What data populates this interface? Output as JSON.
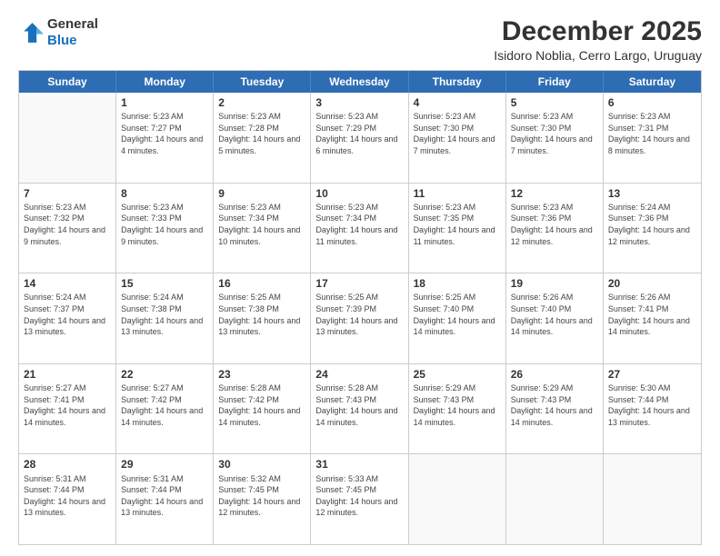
{
  "logo": {
    "line1": "General",
    "line2": "Blue"
  },
  "title": "December 2025",
  "subtitle": "Isidoro Noblia, Cerro Largo, Uruguay",
  "header_days": [
    "Sunday",
    "Monday",
    "Tuesday",
    "Wednesday",
    "Thursday",
    "Friday",
    "Saturday"
  ],
  "weeks": [
    [
      {
        "day": "",
        "empty": true
      },
      {
        "day": "1",
        "sunrise": "Sunrise: 5:23 AM",
        "sunset": "Sunset: 7:27 PM",
        "daylight": "Daylight: 14 hours and 4 minutes."
      },
      {
        "day": "2",
        "sunrise": "Sunrise: 5:23 AM",
        "sunset": "Sunset: 7:28 PM",
        "daylight": "Daylight: 14 hours and 5 minutes."
      },
      {
        "day": "3",
        "sunrise": "Sunrise: 5:23 AM",
        "sunset": "Sunset: 7:29 PM",
        "daylight": "Daylight: 14 hours and 6 minutes."
      },
      {
        "day": "4",
        "sunrise": "Sunrise: 5:23 AM",
        "sunset": "Sunset: 7:30 PM",
        "daylight": "Daylight: 14 hours and 7 minutes."
      },
      {
        "day": "5",
        "sunrise": "Sunrise: 5:23 AM",
        "sunset": "Sunset: 7:30 PM",
        "daylight": "Daylight: 14 hours and 7 minutes."
      },
      {
        "day": "6",
        "sunrise": "Sunrise: 5:23 AM",
        "sunset": "Sunset: 7:31 PM",
        "daylight": "Daylight: 14 hours and 8 minutes."
      }
    ],
    [
      {
        "day": "7",
        "sunrise": "Sunrise: 5:23 AM",
        "sunset": "Sunset: 7:32 PM",
        "daylight": "Daylight: 14 hours and 9 minutes."
      },
      {
        "day": "8",
        "sunrise": "Sunrise: 5:23 AM",
        "sunset": "Sunset: 7:33 PM",
        "daylight": "Daylight: 14 hours and 9 minutes."
      },
      {
        "day": "9",
        "sunrise": "Sunrise: 5:23 AM",
        "sunset": "Sunset: 7:34 PM",
        "daylight": "Daylight: 14 hours and 10 minutes."
      },
      {
        "day": "10",
        "sunrise": "Sunrise: 5:23 AM",
        "sunset": "Sunset: 7:34 PM",
        "daylight": "Daylight: 14 hours and 11 minutes."
      },
      {
        "day": "11",
        "sunrise": "Sunrise: 5:23 AM",
        "sunset": "Sunset: 7:35 PM",
        "daylight": "Daylight: 14 hours and 11 minutes."
      },
      {
        "day": "12",
        "sunrise": "Sunrise: 5:23 AM",
        "sunset": "Sunset: 7:36 PM",
        "daylight": "Daylight: 14 hours and 12 minutes."
      },
      {
        "day": "13",
        "sunrise": "Sunrise: 5:24 AM",
        "sunset": "Sunset: 7:36 PM",
        "daylight": "Daylight: 14 hours and 12 minutes."
      }
    ],
    [
      {
        "day": "14",
        "sunrise": "Sunrise: 5:24 AM",
        "sunset": "Sunset: 7:37 PM",
        "daylight": "Daylight: 14 hours and 13 minutes."
      },
      {
        "day": "15",
        "sunrise": "Sunrise: 5:24 AM",
        "sunset": "Sunset: 7:38 PM",
        "daylight": "Daylight: 14 hours and 13 minutes."
      },
      {
        "day": "16",
        "sunrise": "Sunrise: 5:25 AM",
        "sunset": "Sunset: 7:38 PM",
        "daylight": "Daylight: 14 hours and 13 minutes."
      },
      {
        "day": "17",
        "sunrise": "Sunrise: 5:25 AM",
        "sunset": "Sunset: 7:39 PM",
        "daylight": "Daylight: 14 hours and 13 minutes."
      },
      {
        "day": "18",
        "sunrise": "Sunrise: 5:25 AM",
        "sunset": "Sunset: 7:40 PM",
        "daylight": "Daylight: 14 hours and 14 minutes."
      },
      {
        "day": "19",
        "sunrise": "Sunrise: 5:26 AM",
        "sunset": "Sunset: 7:40 PM",
        "daylight": "Daylight: 14 hours and 14 minutes."
      },
      {
        "day": "20",
        "sunrise": "Sunrise: 5:26 AM",
        "sunset": "Sunset: 7:41 PM",
        "daylight": "Daylight: 14 hours and 14 minutes."
      }
    ],
    [
      {
        "day": "21",
        "sunrise": "Sunrise: 5:27 AM",
        "sunset": "Sunset: 7:41 PM",
        "daylight": "Daylight: 14 hours and 14 minutes."
      },
      {
        "day": "22",
        "sunrise": "Sunrise: 5:27 AM",
        "sunset": "Sunset: 7:42 PM",
        "daylight": "Daylight: 14 hours and 14 minutes."
      },
      {
        "day": "23",
        "sunrise": "Sunrise: 5:28 AM",
        "sunset": "Sunset: 7:42 PM",
        "daylight": "Daylight: 14 hours and 14 minutes."
      },
      {
        "day": "24",
        "sunrise": "Sunrise: 5:28 AM",
        "sunset": "Sunset: 7:43 PM",
        "daylight": "Daylight: 14 hours and 14 minutes."
      },
      {
        "day": "25",
        "sunrise": "Sunrise: 5:29 AM",
        "sunset": "Sunset: 7:43 PM",
        "daylight": "Daylight: 14 hours and 14 minutes."
      },
      {
        "day": "26",
        "sunrise": "Sunrise: 5:29 AM",
        "sunset": "Sunset: 7:43 PM",
        "daylight": "Daylight: 14 hours and 14 minutes."
      },
      {
        "day": "27",
        "sunrise": "Sunrise: 5:30 AM",
        "sunset": "Sunset: 7:44 PM",
        "daylight": "Daylight: 14 hours and 13 minutes."
      }
    ],
    [
      {
        "day": "28",
        "sunrise": "Sunrise: 5:31 AM",
        "sunset": "Sunset: 7:44 PM",
        "daylight": "Daylight: 14 hours and 13 minutes."
      },
      {
        "day": "29",
        "sunrise": "Sunrise: 5:31 AM",
        "sunset": "Sunset: 7:44 PM",
        "daylight": "Daylight: 14 hours and 13 minutes."
      },
      {
        "day": "30",
        "sunrise": "Sunrise: 5:32 AM",
        "sunset": "Sunset: 7:45 PM",
        "daylight": "Daylight: 14 hours and 12 minutes."
      },
      {
        "day": "31",
        "sunrise": "Sunrise: 5:33 AM",
        "sunset": "Sunset: 7:45 PM",
        "daylight": "Daylight: 14 hours and 12 minutes."
      },
      {
        "day": "",
        "empty": true
      },
      {
        "day": "",
        "empty": true
      },
      {
        "day": "",
        "empty": true
      }
    ]
  ]
}
